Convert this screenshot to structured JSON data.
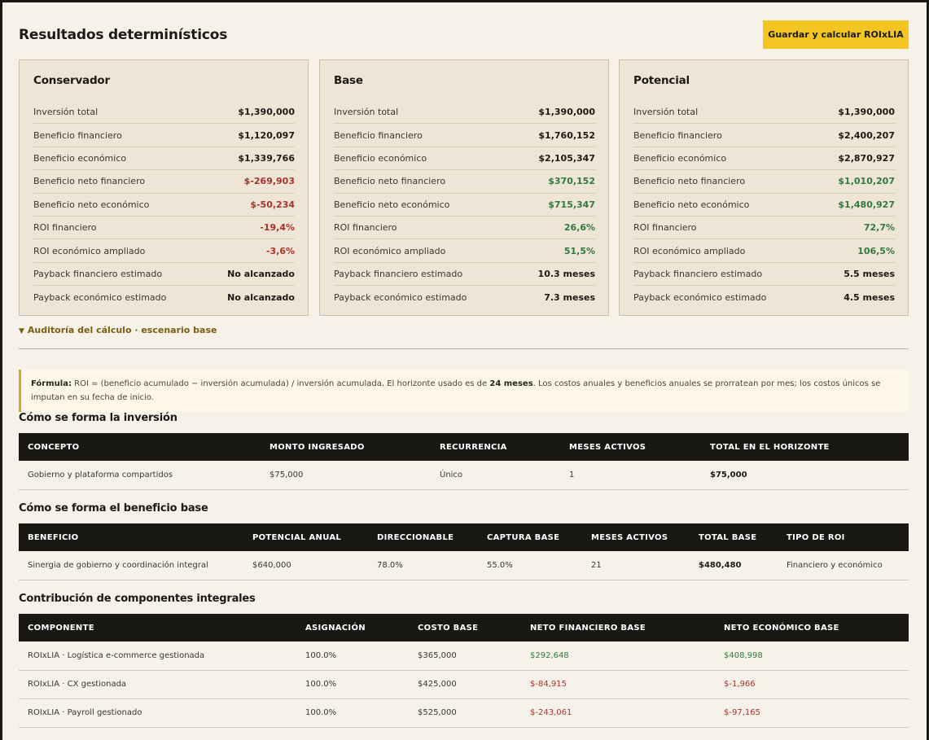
{
  "header": {
    "title": "Resultados determinísticos",
    "save_label": "Guardar y calcular ROIxLIA"
  },
  "row_labels": [
    "Inversión total",
    "Beneficio financiero",
    "Beneficio económico",
    "Beneficio neto financiero",
    "Beneficio neto económico",
    "ROI financiero",
    "ROI económico ampliado",
    "Payback financiero estimado",
    "Payback económico estimado"
  ],
  "scenarios": [
    {
      "name": "Conservador",
      "values": [
        "$1,390,000",
        "$1,120,097",
        "$1,339,766",
        "$-269,903",
        "$-50,234",
        "-19,4%",
        "-3,6%",
        "No alcanzado",
        "No alcanzado"
      ],
      "tones": [
        "",
        "",
        "",
        "neg",
        "neg",
        "neg",
        "neg",
        "",
        ""
      ]
    },
    {
      "name": "Base",
      "values": [
        "$1,390,000",
        "$1,760,152",
        "$2,105,347",
        "$370,152",
        "$715,347",
        "26,6%",
        "51,5%",
        "10.3 meses",
        "7.3 meses"
      ],
      "tones": [
        "",
        "",
        "",
        "pos",
        "pos",
        "pos",
        "pos",
        "",
        ""
      ]
    },
    {
      "name": "Potencial",
      "values": [
        "$1,390,000",
        "$2,400,207",
        "$2,870,927",
        "$1,010,207",
        "$1,480,927",
        "72,7%",
        "106,5%",
        "5.5 meses",
        "4.5 meses"
      ],
      "tones": [
        "",
        "",
        "",
        "pos",
        "pos",
        "pos",
        "pos",
        "",
        ""
      ]
    }
  ],
  "audit": {
    "label": "Auditoría del cálculo · escenario base"
  },
  "formula": {
    "label": "Fórmula:",
    "text_1": " ROI = (beneficio acumulado − inversión acumulada) / inversión acumulada. El horizonte usado es de ",
    "horizon": "24 meses",
    "text_2": ". Los costos anuales y beneficios anuales se prorratean por mes; los costos únicos se imputan en su fecha de inicio."
  },
  "investment": {
    "title": "Cómo se forma la inversión",
    "columns": [
      "CONCEPTO",
      "MONTO INGRESADO",
      "RECURRENCIA",
      "MESES ACTIVOS",
      "TOTAL EN EL HORIZONTE"
    ],
    "rows": [
      [
        "Gobierno y plataforma compartidos",
        "$75,000",
        "Único",
        "1",
        "$75,000"
      ]
    ]
  },
  "benefit": {
    "title": "Cómo se forma el beneficio base",
    "columns": [
      "BENEFICIO",
      "POTENCIAL ANUAL",
      "DIRECCIONABLE",
      "CAPTURA BASE",
      "MESES ACTIVOS",
      "TOTAL BASE",
      "TIPO DE ROI"
    ],
    "rows": [
      [
        "Sinergia de gobierno y coordinación integral",
        "$640,000",
        "78.0%",
        "55.0%",
        "21",
        "$480,480",
        "Financiero y económico"
      ]
    ]
  },
  "components": {
    "title": "Contribución de componentes integrales",
    "columns": [
      "COMPONENTE",
      "ASIGNACIÓN",
      "COSTO BASE",
      "NETO FINANCIERO BASE",
      "NETO ECONÓMICO BASE"
    ],
    "rows": [
      [
        "ROIxLIA · Logística e-commerce gestionada",
        "100.0%",
        "$365,000",
        "$292,648",
        "$408,998"
      ],
      [
        "ROIxLIA · CX gestionada",
        "100.0%",
        "$425,000",
        "$-84,915",
        "$-1,966"
      ],
      [
        "ROIxLIA · Payroll gestionado",
        "100.0%",
        "$525,000",
        "$-243,061",
        "$-97,165"
      ]
    ]
  }
}
